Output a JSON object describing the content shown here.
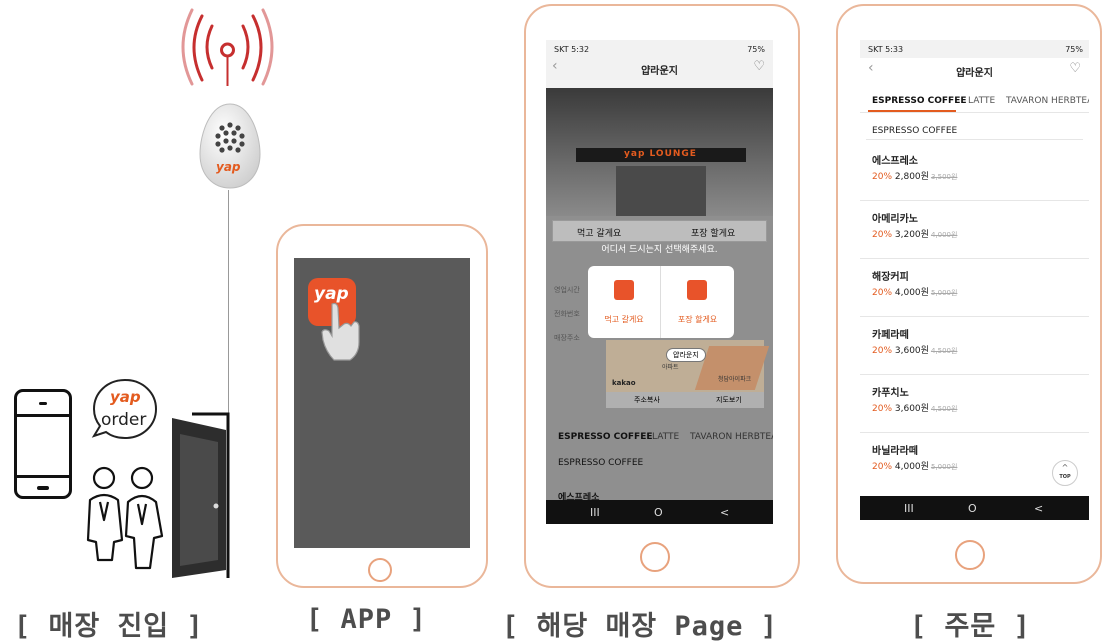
{
  "captions": {
    "entry": "[ 매장 진입 ]",
    "app": "[ APP ]",
    "store_page": "[ 해당 매장 Page ]",
    "order": "[ 주문 ]"
  },
  "device": {
    "logo_text": "yap"
  },
  "order_bubble": {
    "logo_text": "yap",
    "text": "order"
  },
  "app_icon": {
    "text": "yap"
  },
  "store_phone": {
    "status_left": "SKT 5:32",
    "status_right": "75%",
    "title": "얍라운지",
    "signage": "yap LOUNGE",
    "option_dine_in": "먹고 갈게요",
    "option_takeout": "포장 할게요",
    "prompt": "어디서 드시는지 선택해주세요.",
    "info_labels": [
      "영업시간",
      "전화번호",
      "매장주소"
    ],
    "map_label": "얍라운지",
    "map_brand": "kakao",
    "map_places": [
      "아파트",
      "청담아이파크"
    ],
    "copy_address": "주소복사",
    "view_map": "지도보기",
    "tabs": [
      "ESPRESSO COFFEE",
      "LATTE",
      "TAVARON HERBTEA"
    ],
    "section_title": "ESPRESSO COFFEE",
    "first_item": "에스프레소",
    "nav": [
      "III",
      "O",
      "<"
    ]
  },
  "order_phone": {
    "status_left": "SKT 5:33",
    "status_right": "75%",
    "title": "얍라운지",
    "tabs": [
      "ESPRESSO COFFEE",
      "LATTE",
      "TAVARON HERBTEA"
    ],
    "section_title": "ESPRESSO COFFEE",
    "items": [
      {
        "name": "에스프레소",
        "discount": "20%",
        "price": "2,800원",
        "original": "3,500원"
      },
      {
        "name": "아메리카노",
        "discount": "20%",
        "price": "3,200원",
        "original": "4,000원"
      },
      {
        "name": "해장커피",
        "discount": "20%",
        "price": "4,000원",
        "original": "5,000원"
      },
      {
        "name": "카페라떼",
        "discount": "20%",
        "price": "3,600원",
        "original": "4,500원"
      },
      {
        "name": "카푸치노",
        "discount": "20%",
        "price": "3,600원",
        "original": "4,500원"
      },
      {
        "name": "바닐라라떼",
        "discount": "20%",
        "price": "4,000원",
        "original": "5,000원"
      }
    ],
    "top_button": "TOP",
    "nav": [
      "III",
      "O",
      "<"
    ]
  },
  "colors": {
    "accent": "#e35b1f",
    "phone_outline": "#eab79a",
    "signal": "#c62f2f"
  }
}
